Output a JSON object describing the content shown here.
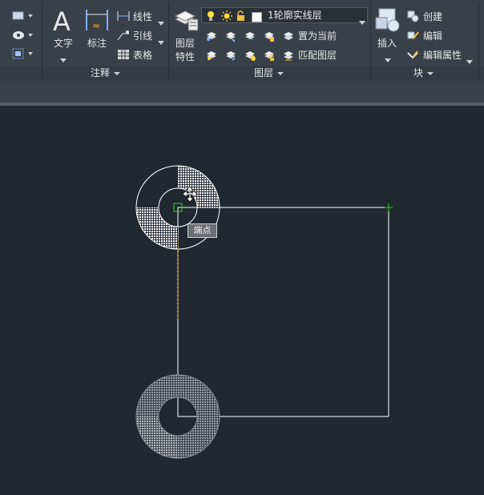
{
  "annotation_panel": {
    "text_button": "文字",
    "dimension_button": "标注",
    "linear_label": "线性",
    "leader_label": "引线",
    "table_label": "表格",
    "title": "注释"
  },
  "layers_panel": {
    "layer_properties_top": "图层",
    "layer_properties_bottom": "特性",
    "current_layer": "1轮廓实线层",
    "set_current": "置为当前",
    "match_layer": "匹配图层",
    "title": "图层"
  },
  "block_panel": {
    "insert_button": "插入",
    "create": "创建",
    "edit": "编辑",
    "edit_attributes": "编辑属性",
    "title": "块"
  },
  "drawing": {
    "snap_tooltip": "端点"
  },
  "colors": {
    "canvas_bg": "#212830",
    "ribbon_bg": "#3a4049",
    "line_white": "#ffffff",
    "snap_green": "#22c222",
    "tracking_orange": "#e8a23a"
  }
}
